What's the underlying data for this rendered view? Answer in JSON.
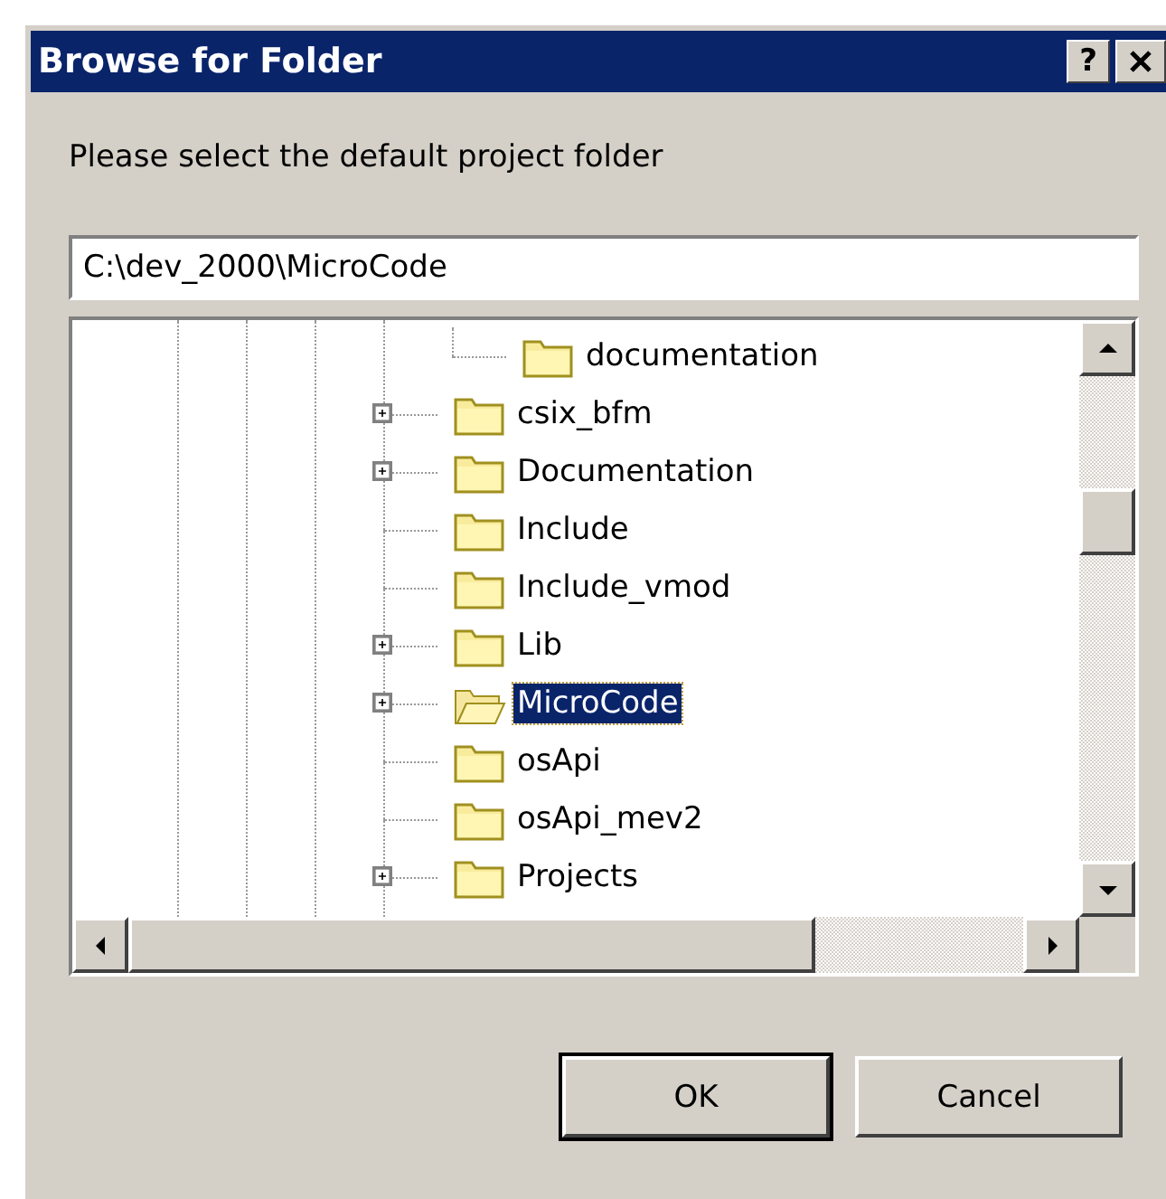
{
  "window": {
    "title": "Browse for Folder",
    "help_button": "?"
  },
  "prompt": "Please select the default project folder",
  "path_field": {
    "value": "C:\\dev_2000\\MicroCode"
  },
  "tree": {
    "items": [
      {
        "children": [
          {
            "label": "documentation",
            "has_children": false,
            "selected": false
          }
        ]
      },
      {
        "label": "csix_bfm",
        "has_children": true,
        "selected": false
      },
      {
        "label": "Documentation",
        "has_children": true,
        "selected": false
      },
      {
        "label": "Include",
        "has_children": false,
        "selected": false
      },
      {
        "label": "Include_vmod",
        "has_children": false,
        "selected": false
      },
      {
        "label": "Lib",
        "has_children": true,
        "selected": false
      },
      {
        "label": "MicroCode",
        "has_children": true,
        "selected": true
      },
      {
        "label": "osApi",
        "has_children": false,
        "selected": false
      },
      {
        "label": "osApi_mev2",
        "has_children": false,
        "selected": false
      },
      {
        "label": "Projects",
        "has_children": true,
        "selected": false
      }
    ]
  },
  "buttons": [
    {
      "label": "OK",
      "default": true
    },
    {
      "label": "Cancel",
      "default": false
    }
  ]
}
